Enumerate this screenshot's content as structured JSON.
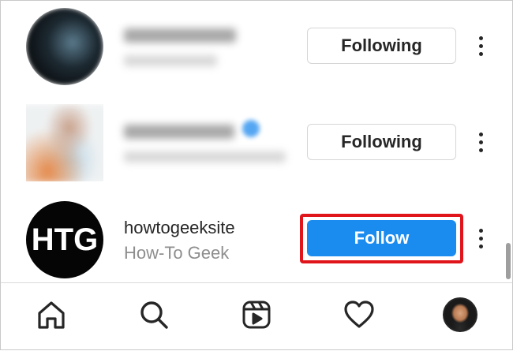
{
  "list": {
    "rows": [
      {
        "username": "",
        "full_name": "",
        "button_label": "Following"
      },
      {
        "username": "",
        "full_name": "",
        "button_label": "Following"
      },
      {
        "username": "howtogeeksite",
        "full_name": "How-To Geek",
        "avatar_text": "HTG",
        "button_label": "Follow"
      }
    ]
  },
  "colors": {
    "follow_button": "#1a8cf0",
    "highlight_border": "#e0141b",
    "text_primary": "#262626",
    "text_secondary": "#8e8e8e"
  },
  "tabbar": {
    "items": [
      {
        "icon": "home-icon"
      },
      {
        "icon": "search-icon"
      },
      {
        "icon": "reels-icon"
      },
      {
        "icon": "heart-icon"
      },
      {
        "icon": "profile-avatar"
      }
    ]
  }
}
